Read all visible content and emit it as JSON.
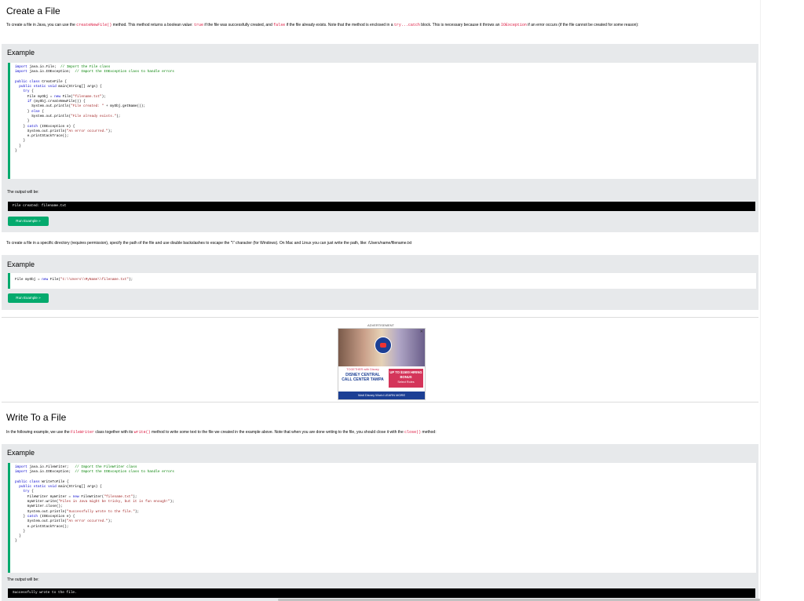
{
  "create": {
    "title": "Create a File",
    "intro": {
      "t1": "To create a file in Java, you can use the ",
      "c1": "createNewFile()",
      "t2": " method. This method returns a boolean value: ",
      "c2": "true",
      "t3": " if the file was successfully created, and ",
      "c3": "false",
      "t4": " if the file already exists. Note that the method is enclosed in a ",
      "c4": "try...catch",
      "t5": " block. This is necessary because it throws an ",
      "c5": "IOException",
      "t6": " if an error occurs (if the file cannot be created for some reason):"
    },
    "example_label": "Example",
    "output_label": "The output will be:",
    "output": "File created: filename.txt",
    "run_label": "Run Example »"
  },
  "path": {
    "text": "To create a file in a specific directory (requires permission), specify the path of the file and use double backslashes to escape the \"\\\" character (for Windows). On Mac and Linux you can just write the path, like: /Users/name/filename.txt",
    "example_label": "Example",
    "run_label": "Run Example »"
  },
  "ad": {
    "label": "ADVERTISEMENT",
    "close": "✕",
    "together": "TOGETHER with Disney",
    "headline": "DISNEY CENTRAL CALL CENTER TAMPA",
    "bonus": "UP TO $1500 HIRING BONUS",
    "roles": "Select Roles",
    "footer": "Walt Disney World   LEARN MORE"
  },
  "write": {
    "title": "Write To a File",
    "intro": {
      "t1": "In the following example, we use the ",
      "c1": "FileWriter",
      "t2": " class together with its ",
      "c2": "write()",
      "t3": " method to write some text to the file we created in the example above. Note that when you are done writing to the file, you should close it with the ",
      "c3": "close()",
      "t4": " method:"
    },
    "example_label": "Example",
    "output_label": "The output will be:",
    "output": "Successfully wrote to the file."
  },
  "colors": {
    "accent": "#04aa6d",
    "example_bg": "#e7e9eb",
    "inline_code": "#dc143c"
  }
}
